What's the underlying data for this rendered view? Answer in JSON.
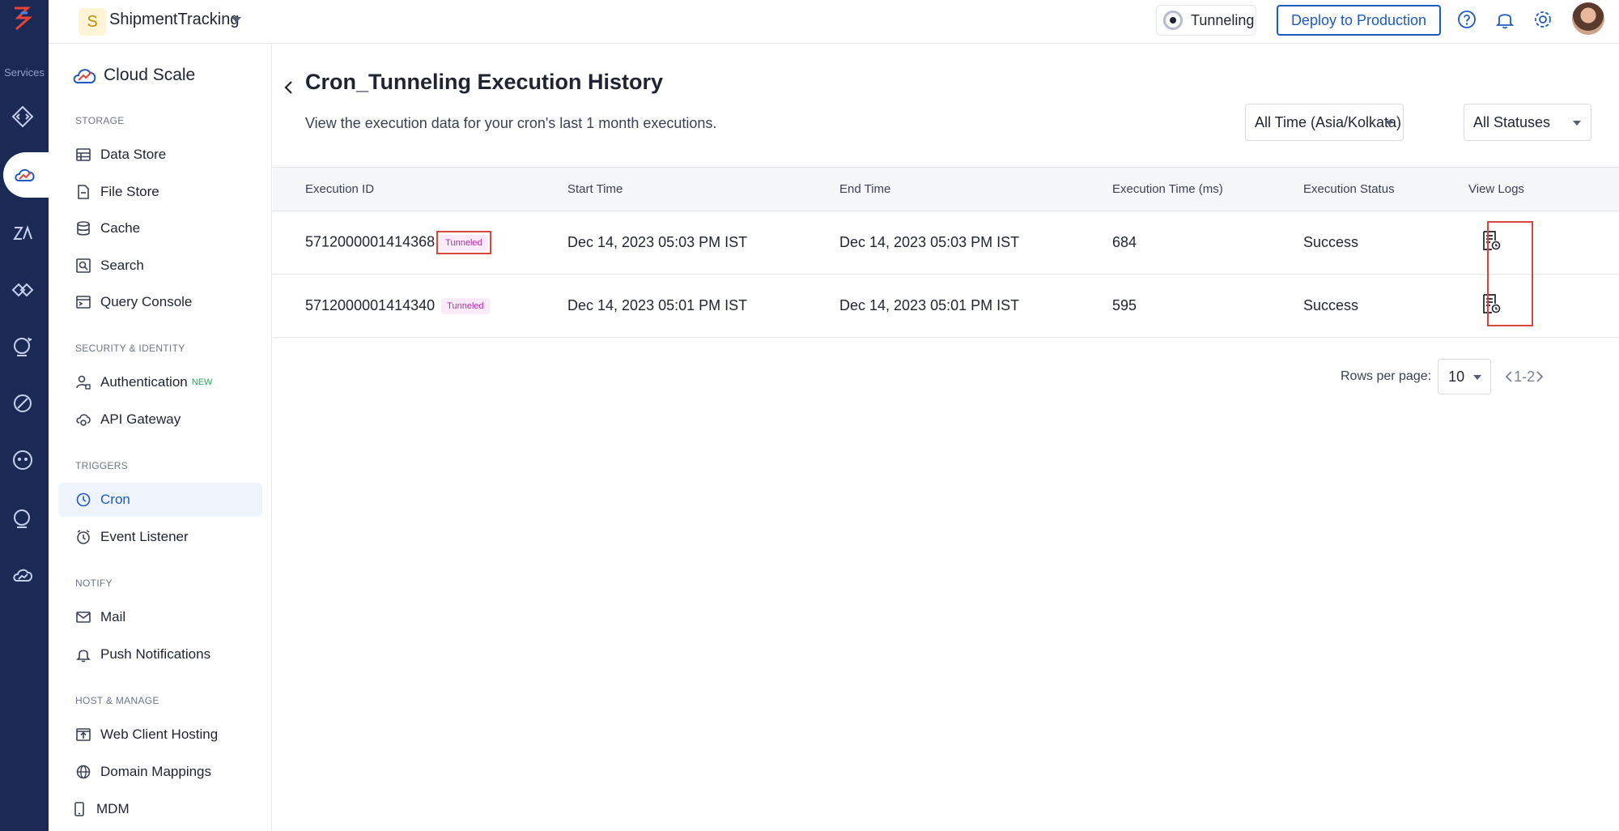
{
  "rail": {
    "services_label": "Services"
  },
  "topbar": {
    "project_initial": "S",
    "project_name": "ShipmentTracking",
    "environment": "Tunneling",
    "deploy_label": "Deploy to Production"
  },
  "sidebar": {
    "title": "Cloud Scale",
    "sections": [
      {
        "label": "STORAGE"
      },
      {
        "label": "SECURITY & IDENTITY"
      },
      {
        "label": "TRIGGERS"
      },
      {
        "label": "NOTIFY"
      },
      {
        "label": "HOST & MANAGE"
      }
    ],
    "items": [
      {
        "label": "Data Store",
        "icon": "table-icon"
      },
      {
        "label": "File Store",
        "icon": "file-icon"
      },
      {
        "label": "Cache",
        "icon": "database-icon"
      },
      {
        "label": "Search",
        "icon": "search-icon"
      },
      {
        "label": "Query Console",
        "icon": "console-icon"
      },
      {
        "label": "Authentication",
        "icon": "user-lock-icon",
        "badge": "NEW"
      },
      {
        "label": "API Gateway",
        "icon": "gateway-icon"
      },
      {
        "label": "Cron",
        "icon": "clock-icon",
        "active": true
      },
      {
        "label": "Event Listener",
        "icon": "timer-icon"
      },
      {
        "label": "Mail",
        "icon": "mail-icon"
      },
      {
        "label": "Push Notifications",
        "icon": "bell-icon"
      },
      {
        "label": "Web Client Hosting",
        "icon": "upload-icon"
      },
      {
        "label": "Domain Mappings",
        "icon": "globe-icon"
      },
      {
        "label": "MDM",
        "icon": "phone-icon"
      }
    ]
  },
  "main": {
    "title": "Cron_Tunneling Execution History",
    "subtitle": "View the execution data for your cron's last 1 month executions.",
    "time_filter": "All Time (Asia/Kolkata)",
    "status_filter": "All Statuses",
    "columns": [
      "Execution ID",
      "Start Time",
      "End Time",
      "Execution Time (ms)",
      "Execution Status",
      "View Logs"
    ],
    "rows": [
      {
        "id": "5712000001414368",
        "tag": "Tunneled",
        "start": "Dec 14, 2023 05:03 PM IST",
        "end": "Dec 14, 2023 05:03 PM IST",
        "duration": "684",
        "status": "Success"
      },
      {
        "id": "5712000001414340",
        "tag": "Tunneled",
        "start": "Dec 14, 2023 05:01 PM IST",
        "end": "Dec 14, 2023 05:01 PM IST",
        "duration": "595",
        "status": "Success"
      }
    ],
    "pager": {
      "rows_label": "Rows per page:",
      "rows_value": "10",
      "range": "1-2"
    }
  },
  "colors": {
    "accent": "#1e5bbf",
    "rail": "#1b2a55",
    "success": "#1f8a3a",
    "tag": "#b030a8",
    "highlight": "#d9463a"
  }
}
